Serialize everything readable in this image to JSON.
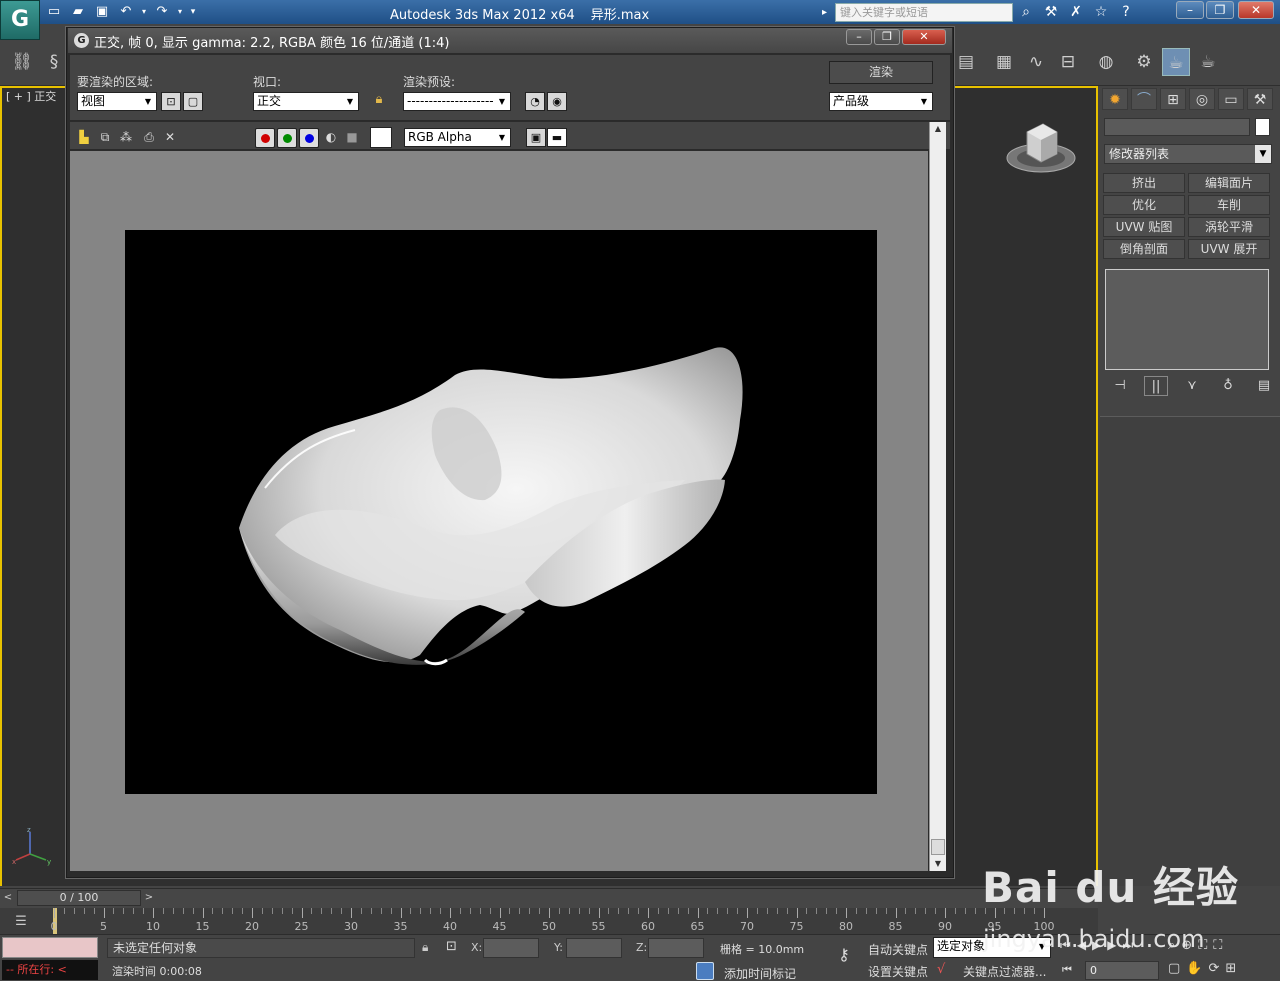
{
  "app": {
    "title": "Autodesk 3ds Max  2012 x64",
    "file": "异形.max",
    "logo": "G",
    "search_placeholder": "键入关键字或短语",
    "viewport_label": "[ + ] 正交"
  },
  "render_window": {
    "title": "正交, 帧 0, 显示 gamma: 2.2, RGBA 颜色 16 位/通道 (1:4)",
    "area_label": "要渲染的区域:",
    "area_value": "视图",
    "viewport_label": "视口:",
    "viewport_value": "正交",
    "preset_label": "渲染预设:",
    "preset_value": "--------------------",
    "render_button": "渲染",
    "quality_value": "产品级",
    "channel_value": "RGB Alpha",
    "channel_colors": {
      "red": "#d00000",
      "green": "#008a00",
      "blue": "#0000e0"
    }
  },
  "command_panel": {
    "modifier_list": "修改器列表",
    "buttons": [
      "挤出",
      "编辑面片",
      "优化",
      "车削",
      "UVW 贴图",
      "涡轮平滑",
      "倒角剖面",
      "UVW 展开"
    ]
  },
  "timeline": {
    "position": "0 / 100",
    "ticks": [
      "0",
      "5",
      "10",
      "15",
      "20",
      "25",
      "30",
      "35",
      "40",
      "45",
      "50",
      "55",
      "60",
      "65",
      "70",
      "75",
      "80",
      "85",
      "90",
      "95",
      "100"
    ]
  },
  "status": {
    "listener": "-- 所在行: <",
    "message": "未选定任何对象",
    "prompt": "渲染时间  0:00:08",
    "x_label": "X:",
    "y_label": "Y:",
    "z_label": "Z:",
    "grid": "栅格 = 10.0mm",
    "autokey": "自动关键点",
    "setkey": "设置关键点",
    "selection": "选定对象",
    "key_filters": "关键点过滤器...",
    "add_time_tag": "添加时间标记",
    "frame": "0"
  },
  "watermark": {
    "logo": "Bai du 经验",
    "url": "jingyan.baidu.com"
  },
  "colors": {
    "active_viewport_border": "#e8c200",
    "render_background": "#000000",
    "canvas_gray": "#858585"
  }
}
